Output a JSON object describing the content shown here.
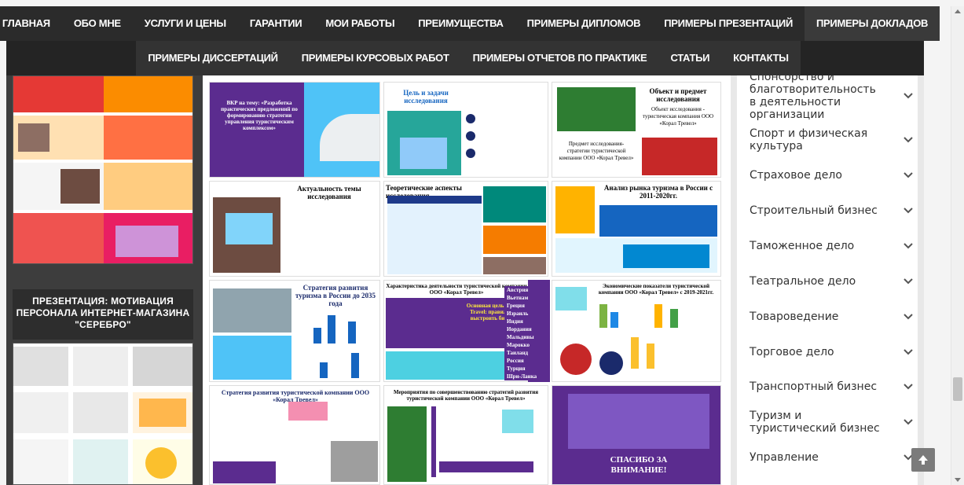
{
  "nav": {
    "row1": [
      "ГЛАВНАЯ",
      "ОБО МНЕ",
      "УСЛУГИ И ЦЕНЫ",
      "ГАРАНТИИ",
      "МОИ РАБОТЫ",
      "ПРЕИМУЩЕСТВА",
      "ПРИМЕРЫ ДИПЛОМОВ",
      "ПРИМЕРЫ ПРЕЗЕНТАЦИЙ",
      "ПРИМЕРЫ ДОКЛАДОВ"
    ],
    "row2": [
      "ПРИМЕРЫ ДИССЕРТАЦИЙ",
      "ПРИМЕРЫ КУРСОВЫХ РАБОТ",
      "ПРИМЕРЫ ОТЧЕТОВ ПО ПРАКТИКЕ",
      "СТАТЬИ",
      "КОНТАКТЫ"
    ]
  },
  "left": {
    "promo_title": "ПРЕЗЕНТАЦИЯ: МОТИВАЦИЯ ПЕРСОНАЛА ИНТЕРНЕТ-МАГАЗИНА \"СЕРЕБРО\"",
    "promo_line1": "ПРЕЗЕНТАЦИЯ: МОТИВАЦИЯ",
    "promo_line2": "ПЕРСОНАЛА ИНТЕРНЕТ-МАГАЗИНА",
    "promo_line3": "\"СЕРЕБРО\""
  },
  "slides": {
    "s1_title": "ВКР на тему: «Разработка практических предложений по формированию стратегии управления туристическим комплексом»",
    "s2_title": "Цель и задачи исследования",
    "s3_title": "Объект и предмет исследования",
    "s3_object": "Объект исследования - туристическая компания ООО «Корал Тревел»",
    "s3_subject": "Предмет исследования- стратегии туристической компании ООО «Корал Тревел»",
    "s4_title": "Актуальность темы исследования",
    "s5_title": "Теоретические аспекты исследования",
    "s6_title": "Анализ рынка туризма в России с 2011-2020гг.",
    "s7_title": "Стратегия развития туризма в России до 2035 года",
    "s8_title": "Характеристика деятельности туристической компании ООО «Корал Тревел»",
    "s8_goal": "Основная цель Coral Travel: правильно выстроить бизнес",
    "s9_countries": [
      "Австрия",
      "Вьетнам",
      "Греция",
      "Израиль",
      "Индия",
      "Иордания",
      "Мальдивы",
      "Марокко",
      "Таиланд",
      "Россия",
      "Турция",
      "Шри-Ланка"
    ],
    "s10_title": "Экономические показатели туристической компании ООО «Корал Тревел» с 2019-2021гг.",
    "s11_title": "Стратегия развития туристической компании ООО «Корал Тревел»",
    "s12_title": "Мероприятия по совершенствованию стратегий развития туристической компании ООО «Корал Тревел»",
    "s13_title": "СПАСИБО ЗА ВНИМАНИЕ!"
  },
  "menu": [
    "Спонсорство и благотворительность в деятельности организации",
    "Спорт и физическая культура",
    "Страховое дело",
    "Строительный бизнес",
    "Таможенное дело",
    "Театральное дело",
    "Товароведение",
    "Торговое дело",
    "Транспортный бизнес",
    "Туризм и туристический бизнес",
    "Управление"
  ],
  "icons": {
    "chevron": "chevron-down-icon",
    "to_top": "arrow-up-icon"
  },
  "colors": {
    "nav_bg": "#2b2b2b",
    "sidebar_bg": "#3d3d3d",
    "accent_purple": "#5b2c8f",
    "accent_blue": "#1565c0",
    "accent_orange": "#f57c00"
  }
}
